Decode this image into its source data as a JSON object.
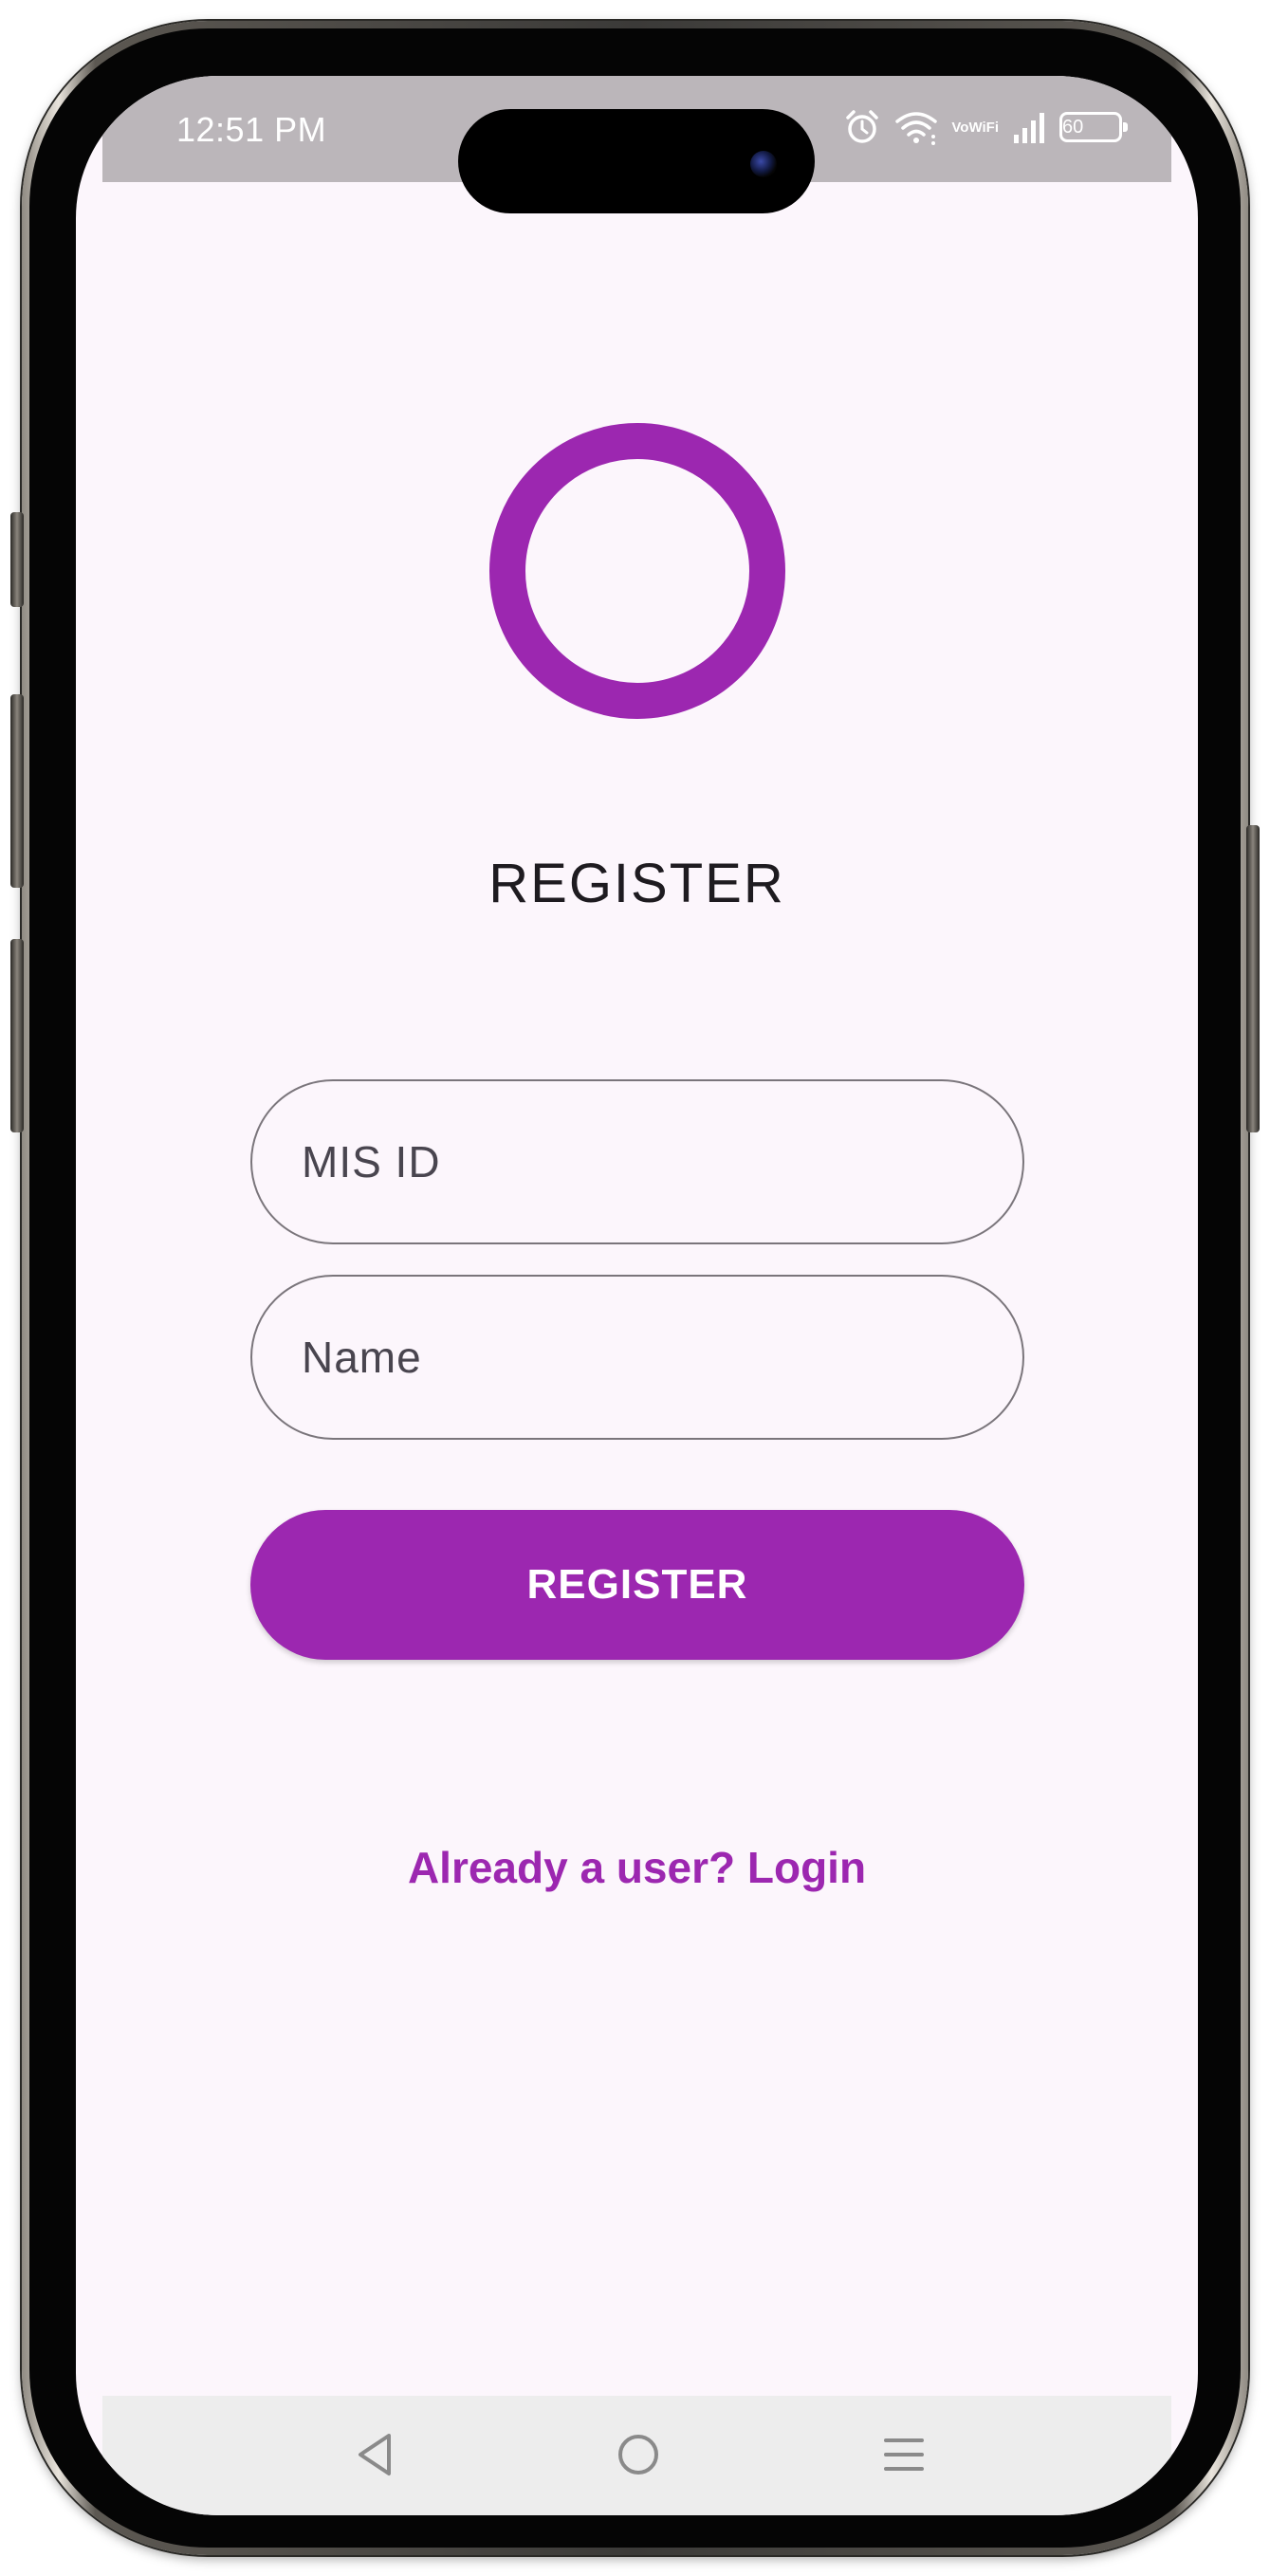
{
  "status_bar": {
    "time": "12:51 PM",
    "network_label_top": "Vo",
    "network_label_bottom": "WiFi",
    "battery": "60",
    "icons": [
      "alarm-icon",
      "wifi-icon",
      "signal-icon",
      "battery-icon"
    ]
  },
  "app": {
    "title": "REGISTER",
    "accent_color": "#9c27b0",
    "background_color": "#fcf6fc",
    "form": {
      "mis_id": {
        "value": "",
        "placeholder": "MIS ID"
      },
      "name": {
        "value": "",
        "placeholder": "Name"
      },
      "submit_label": "REGISTER"
    },
    "login_link": "Already a user? Login"
  },
  "nav_bar": {
    "icons": [
      "back-icon",
      "home-icon",
      "menu-icon"
    ]
  }
}
